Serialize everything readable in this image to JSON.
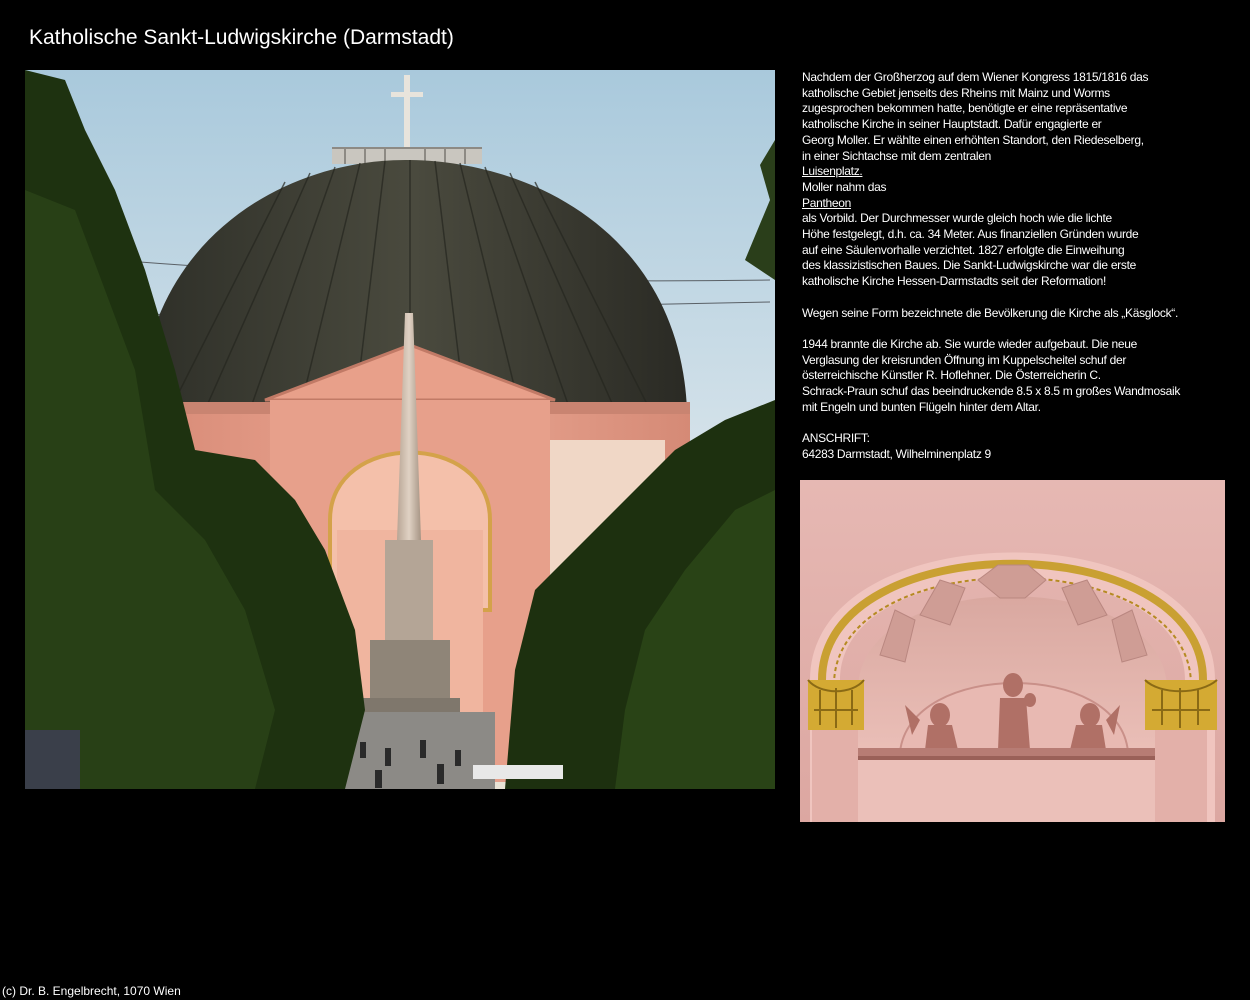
{
  "page": {
    "title": "Katholische Sankt-Ludwigskirche (Darmstadt)"
  },
  "description": {
    "paragraph1": {
      "lines_a": [
        "Nachdem der Großherzog auf dem Wiener Kongress 1815/1816 das",
        "katholische Gebiet jenseits des Rheins mit Mainz und Worms",
        "zugesprochen bekommen hatte, benötigte er eine repräsentative",
        "katholische Kirche in seiner Hauptstadt. Dafür engagierte er",
        "Georg Moller. Er wählte einen erhöhten Standort, den Riedeselberg,",
        "in einer Sichtachse mit dem zentralen"
      ],
      "link_luisenplatz": "Luisenplatz.",
      "line_moller": "Moller nahm das",
      "link_pantheon": "Pantheon",
      "lines_b": [
        "als Vorbild. Der Durchmesser wurde gleich hoch wie die lichte",
        "Höhe festgelegt, d.h. ca. 34 Meter. Aus finanziellen Gründen wurde",
        "auf eine Säulenvorhalle verzichtet. 1827 erfolgte die Einweihung",
        "des klassizistischen Baues. Die Sankt-Ludwigskirche war die erste",
        "katholische Kirche Hessen-Darmstadts seit der Reformation!"
      ]
    },
    "paragraph2": "Wegen seine Form bezeichnete die Bevölkerung die Kirche als „Käsglock“.",
    "paragraph3": [
      "1944 brannte die Kirche ab. Sie wurde wieder aufgebaut. Die neue",
      "Verglasung der kreisrunden Öffnung im Kuppelscheitel schuf der",
      "österreichische Künstler R. Hoflehner. Die Österreicherin C.",
      "Schrack-Praun schuf das beeindruckende 8.5 x 8.5 m großes Wandmosaik",
      "mit Engeln und bunten Flügeln hinter dem Altar."
    ],
    "address": {
      "label": "ANSCHRIFT:",
      "value": "64283 Darmstadt, Wilhelminenplatz 9"
    }
  },
  "footer": {
    "copyright": "(c) Dr. B. Engelbrecht, 1070 Wien"
  },
  "images": {
    "main_photo_icon": "church-dome-photo",
    "detail_photo_icon": "portal-arch-relief-photo"
  },
  "colors": {
    "background": "#000000",
    "text": "#ffffff",
    "sky": "#c9dde9",
    "dome": "#3a3a30",
    "facade": "#e3a08e",
    "foliage": "#1f3312",
    "wall_pink": "#e4b5b0",
    "gold": "#c9a032"
  }
}
